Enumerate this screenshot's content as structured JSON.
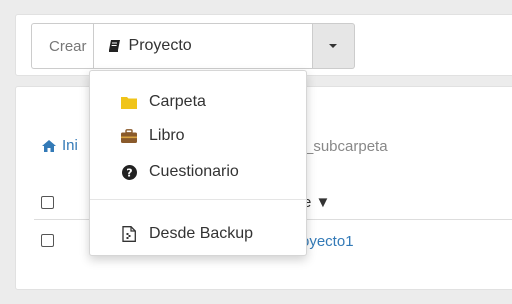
{
  "toolbar": {
    "crear_label": "Crear",
    "selected": {
      "label": "Proyecto",
      "icon": "book-icon"
    }
  },
  "menu": {
    "items": [
      {
        "label": "Carpeta",
        "icon": "folder-icon",
        "color": "#f0c419"
      },
      {
        "label": "Libro",
        "icon": "briefcase-icon",
        "color": "#8a5a2b"
      },
      {
        "label": "Cuestionario",
        "icon": "question-circle-icon",
        "color": "#222222"
      }
    ],
    "backup_item": {
      "label": "Desde Backup",
      "icon": "file-backup-icon"
    }
  },
  "breadcrumb": {
    "home_fragment": "Ini",
    "tail_fragment": "_subcarpeta"
  },
  "table": {
    "header_fragment": "e ▼",
    "row_link_fragment": "royecto1"
  },
  "colors": {
    "link": "#337ab7",
    "background": "#ececec"
  }
}
